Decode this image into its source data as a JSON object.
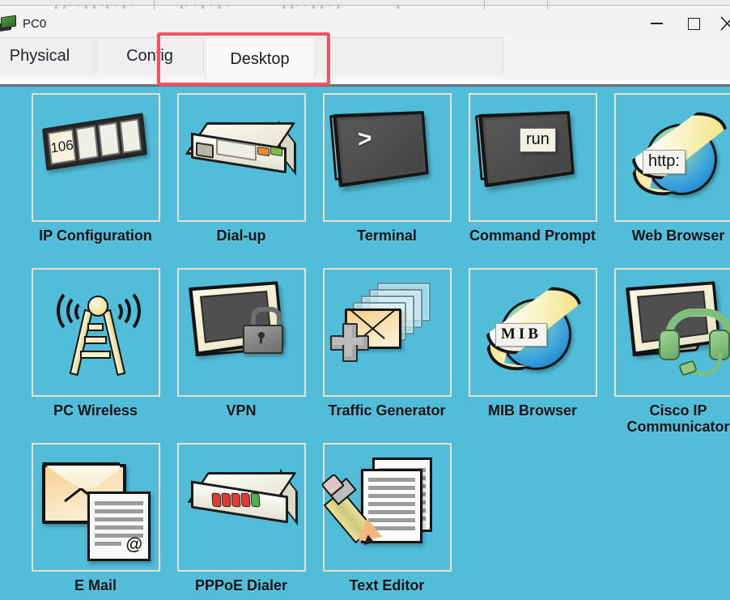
{
  "window": {
    "title": "PC0",
    "icon": "pc-device-icon",
    "controls": {
      "minimize": "—",
      "maximize": "□",
      "close": "✕"
    }
  },
  "tabs": [
    {
      "label": "Physical",
      "active": false
    },
    {
      "label": "Config",
      "active": false
    },
    {
      "label": "Desktop",
      "active": true
    }
  ],
  "annotation": {
    "type": "highlight-rectangle",
    "color": "#f94f63",
    "targets": "Desktop"
  },
  "desktop": {
    "background_color": "#51bdd8",
    "tile_border_color": "#ecdfc9",
    "rows": [
      [
        {
          "label": "IP Configuration",
          "icon": "ip-configuration-icon",
          "badge": "106"
        },
        {
          "label": "Dial-up",
          "icon": "dial-up-modem-icon"
        },
        {
          "label": "Terminal",
          "icon": "terminal-icon",
          "badge": ">"
        },
        {
          "label": "Command Prompt",
          "icon": "command-prompt-icon",
          "badge": "run"
        },
        {
          "label": "Web Browser",
          "icon": "web-browser-globe-icon",
          "badge": "http:"
        }
      ],
      [
        {
          "label": "PC Wireless",
          "icon": "pc-wireless-antenna-icon"
        },
        {
          "label": "VPN",
          "icon": "vpn-lock-icon"
        },
        {
          "label": "Traffic Generator",
          "icon": "traffic-generator-envelopes-icon"
        },
        {
          "label": "MIB Browser",
          "icon": "mib-browser-globe-icon",
          "badge": "MIB"
        },
        {
          "label": "Cisco IP Communicator",
          "icon": "cisco-ip-communicator-headset-icon"
        }
      ],
      [
        {
          "label": "E Mail",
          "icon": "email-envelope-icon",
          "badge": "@"
        },
        {
          "label": "PPPoE Dialer",
          "icon": "pppoe-dialer-modem-icon"
        },
        {
          "label": "Text Editor",
          "icon": "text-editor-pencil-icon"
        }
      ]
    ]
  }
}
